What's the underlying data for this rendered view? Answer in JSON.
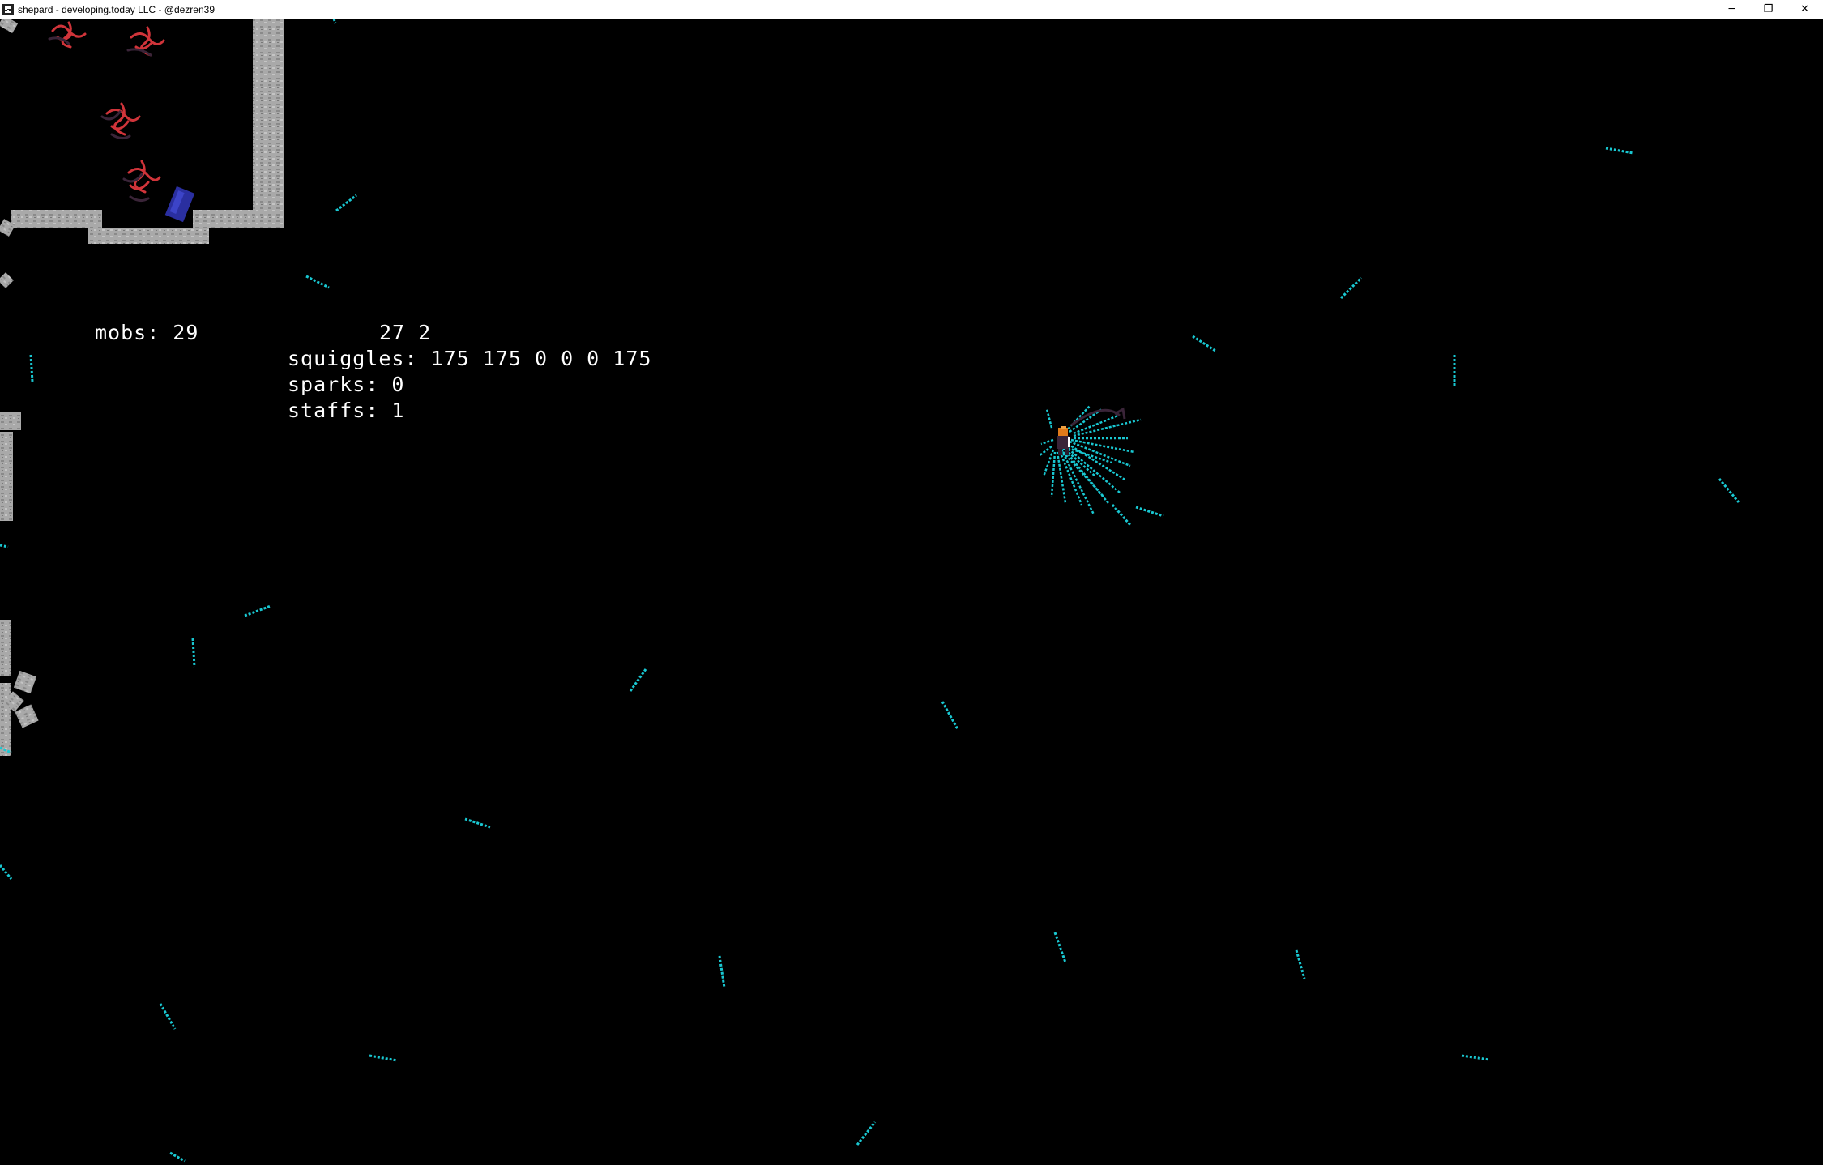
{
  "window": {
    "title": "shepard - developing.today LLC - @dezren39",
    "controls": {
      "minimize": "─",
      "restore": "❐",
      "close": "✕"
    }
  },
  "hud": {
    "mobs": "mobs: 29",
    "coords": "27 2",
    "squiggles": "squiggles: 175 175 0 0 0 175",
    "sparks": "sparks: 0",
    "staffs": "staffs: 1"
  },
  "colors": {
    "background": "#000000",
    "squiggle": "#19c8d2",
    "wall": "#a8a8a8",
    "mob_red": "#d0343a",
    "mob_dark": "#3a2438",
    "crystal": "#2a2fa0",
    "hud_text": "#ffffff"
  },
  "icons": {
    "app": "shepard-app-icon",
    "player": "player-sprite-icon"
  }
}
